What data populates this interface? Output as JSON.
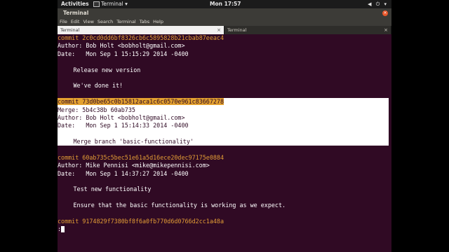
{
  "topbar": {
    "activities": "Activities",
    "app_menu": "Terminal ▾",
    "clock": "Mon 17:57",
    "status_icons": "◀ ⏻ ▾"
  },
  "window": {
    "title": "Terminal",
    "close_glyph": "×"
  },
  "menubar": [
    "File",
    "Edit",
    "View",
    "Search",
    "Terminal",
    "Tabs",
    "Help"
  ],
  "tabs": [
    {
      "label": "Terminal",
      "close": "×"
    },
    {
      "label": "Terminal",
      "close": "×"
    }
  ],
  "terminal": {
    "lines": [
      {
        "kind": "commit",
        "prefix": "commit ",
        "hash": "2c0cd0dd6bf8326cb6c5895828b21cbab87eeac4"
      },
      {
        "kind": "text",
        "text": "Author: Bob Holt <bobholt@gmail.com>"
      },
      {
        "kind": "text",
        "text": "Date:   Mon Sep 1 15:15:29 2014 -0400"
      },
      {
        "kind": "text",
        "text": ""
      },
      {
        "kind": "msg",
        "text": "Release new version"
      },
      {
        "kind": "text",
        "text": ""
      },
      {
        "kind": "msg",
        "text": "We've done it!"
      },
      {
        "kind": "text",
        "text": ""
      },
      {
        "kind": "commit",
        "prefix": "commit ",
        "hash": "73d0be65c0b15812aca1c6c0570e961c83667278",
        "highlight": true
      },
      {
        "kind": "text",
        "text": "Merge: 5b4c38b 60ab735",
        "highlight": true
      },
      {
        "kind": "text",
        "text": "Author: Bob Holt <bobholt@gmail.com>",
        "highlight": true
      },
      {
        "kind": "text",
        "text": "Date:   Mon Sep 1 15:14:33 2014 -0400",
        "highlight": true
      },
      {
        "kind": "text",
        "text": "",
        "highlight": true
      },
      {
        "kind": "msg",
        "text": "Merge branch 'basic-functionality'",
        "highlight": true
      },
      {
        "kind": "text",
        "text": ""
      },
      {
        "kind": "commit",
        "prefix": "commit ",
        "hash": "60ab735c5bec51e61a5d16ece20dec97175e0884"
      },
      {
        "kind": "text",
        "text": "Author: Mike Pennisi <mike@mikepennisi.com>"
      },
      {
        "kind": "text",
        "text": "Date:   Mon Sep 1 14:37:27 2014 -0400"
      },
      {
        "kind": "text",
        "text": ""
      },
      {
        "kind": "msg",
        "text": "Test new functionality"
      },
      {
        "kind": "text",
        "text": ""
      },
      {
        "kind": "msg",
        "text": "Ensure that the basic functionality is working as we expect."
      },
      {
        "kind": "text",
        "text": ""
      },
      {
        "kind": "commit",
        "prefix": "commit ",
        "hash": "9174829f7380bf8f6a0fb770d6d0766d2cc1a48a"
      },
      {
        "kind": "prompt",
        "text": ":"
      }
    ]
  },
  "colors": {
    "terminal_bg": "#300a24",
    "commit_hash": "#e39d35",
    "selection": "#ffffff"
  }
}
